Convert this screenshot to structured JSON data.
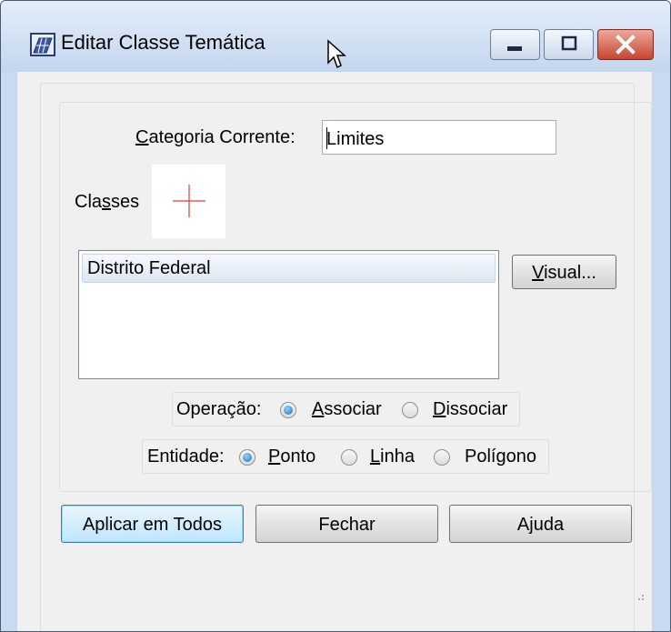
{
  "window": {
    "title": "Editar Classe Temática",
    "controls": {
      "minimize": "minimize",
      "maximize": "maximize",
      "close": "close"
    }
  },
  "form": {
    "categoria_label_underlined": "C",
    "categoria_label_rest": "ategoria Corrente:",
    "categoria_value": "Limites",
    "classes_label_pre": "Cla",
    "classes_label_underlined": "s",
    "classes_label_post": "ses",
    "classes_list": [
      "Distrito Federal"
    ],
    "visual_button_underlined": "V",
    "visual_button_rest": "isual..."
  },
  "operacao": {
    "label": "Operação:",
    "options": [
      {
        "underlined": "A",
        "rest": "ssociar",
        "checked": true
      },
      {
        "underlined": "D",
        "rest": "issociar",
        "checked": false
      }
    ]
  },
  "entidade": {
    "label": "Entidade:",
    "options": [
      {
        "underlined": "P",
        "rest": "onto",
        "checked": true
      },
      {
        "underlined": "L",
        "rest": "inha",
        "checked": false
      },
      {
        "pre": "Polí",
        "underlined": "g",
        "rest": "ono",
        "checked": false
      }
    ]
  },
  "buttons": {
    "aplicar": "Aplicar em Todos",
    "fechar": "Fechar",
    "ajuda": "Ajuda"
  },
  "colors": {
    "accent_cross": "#e03a3a",
    "titlebar": "#c3d6ee",
    "close_button": "#c8442f"
  },
  "icons": {
    "app": "thematic-layer-icon",
    "cursor": "arrow-cursor-icon",
    "preview": "red-cross-icon"
  }
}
